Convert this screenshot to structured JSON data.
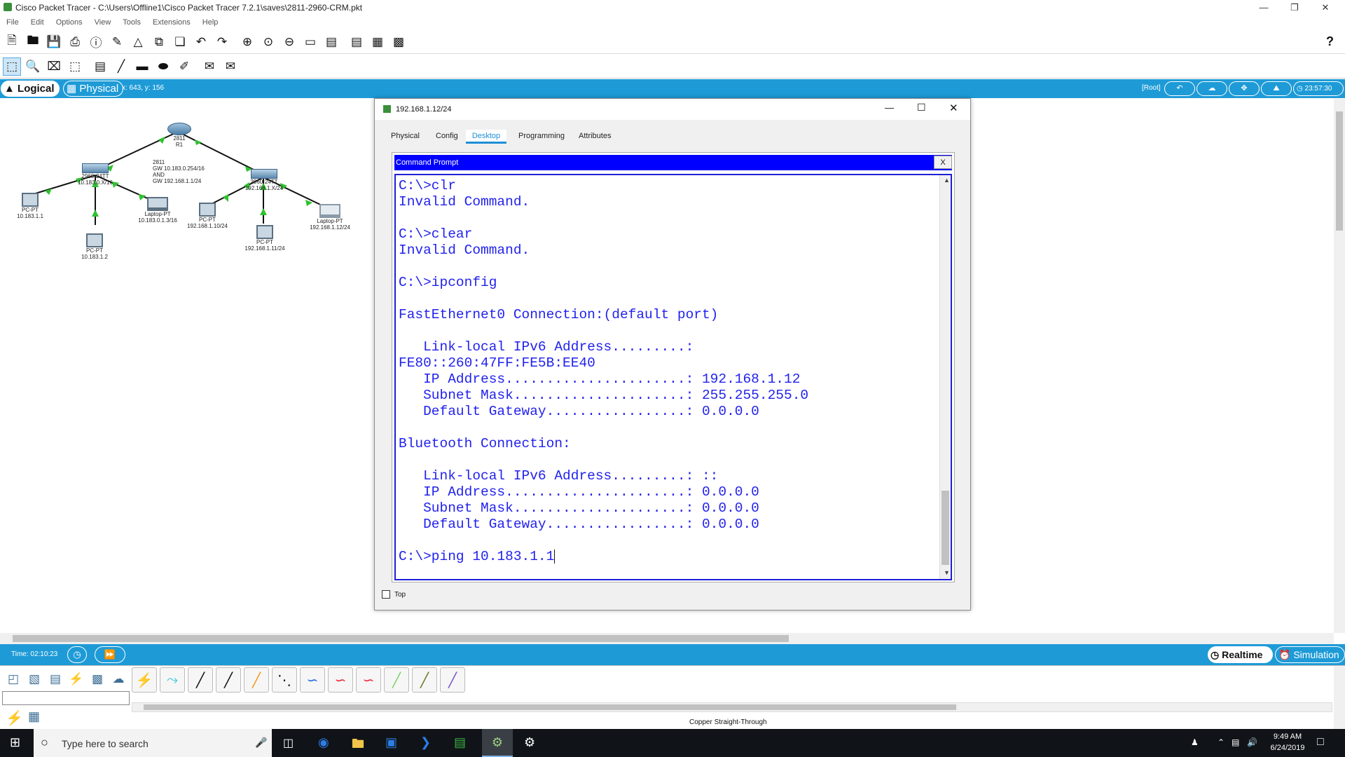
{
  "app": {
    "title": "Cisco Packet Tracer - C:\\Users\\Offline1\\Cisco Packet Tracer 7.2.1\\saves\\2811-2960-CRM.pkt",
    "help_glyph": "?"
  },
  "menu": [
    "File",
    "Edit",
    "Options",
    "View",
    "Tools",
    "Extensions",
    "Help"
  ],
  "workspace_bar": {
    "logical_label": "Logical",
    "physical_label": "Physical",
    "coords": "x: 643, y: 156",
    "root_label": "[Root]",
    "clock": "23:57:30"
  },
  "topology": {
    "router": {
      "model": "2811",
      "name": "R1",
      "notes": [
        "2811",
        "GW 10.183.0.254/16",
        "AND",
        "GW 192.168.1.1/24"
      ]
    },
    "switches": [
      {
        "label1": "2960-24TT",
        "label2": "10.183.0.X/16"
      },
      {
        "label1": "2960-24TT",
        "label2": "192.168.1.X/24"
      }
    ],
    "devices": [
      {
        "type": "PC-PT",
        "ip": "10.183.1.1"
      },
      {
        "type": "PC-PT",
        "ip": "10.183.1.2"
      },
      {
        "type": "Laptop-PT",
        "ip": "10.183.0.1.3/16"
      },
      {
        "type": "PC-PT",
        "ip": "192.168.1.10/24"
      },
      {
        "type": "PC-PT",
        "ip": "192.168.1.11/24"
      },
      {
        "type": "Laptop-PT",
        "ip": "192.168.1.12/24"
      }
    ]
  },
  "dialog": {
    "title": "192.168.1.12/24",
    "tabs": [
      "Physical",
      "Config",
      "Desktop",
      "Programming",
      "Attributes"
    ],
    "active_tab": "Desktop",
    "cmd_title": "Command Prompt",
    "cmd_close": "X",
    "top_label": "Top",
    "terminal": [
      "C:\\>clr",
      "Invalid Command.",
      "",
      "C:\\>clear",
      "Invalid Command.",
      "",
      "C:\\>ipconfig",
      "",
      "FastEthernet0 Connection:(default port)",
      "",
      "   Link-local IPv6 Address.........: ",
      "FE80::260:47FF:FE5B:EE40",
      "   IP Address......................: 192.168.1.12",
      "   Subnet Mask.....................: 255.255.255.0",
      "   Default Gateway.................: 0.0.0.0",
      "",
      "Bluetooth Connection:",
      "",
      "   Link-local IPv6 Address.........: ::",
      "   IP Address......................: 0.0.0.0",
      "   Subnet Mask.....................: 0.0.0.0",
      "   Default Gateway.................: 0.0.0.0",
      "",
      "C:\\>ping 10.183.1.1"
    ]
  },
  "timebar": {
    "time": "Time: 02:10:23",
    "realtime_label": "Realtime",
    "simulation_label": "Simulation"
  },
  "palette": {
    "selected_cable": "Copper Straight-Through"
  },
  "taskbar": {
    "search_placeholder": "Type here to search",
    "time": "9:49 AM",
    "date": "6/24/2019"
  }
}
